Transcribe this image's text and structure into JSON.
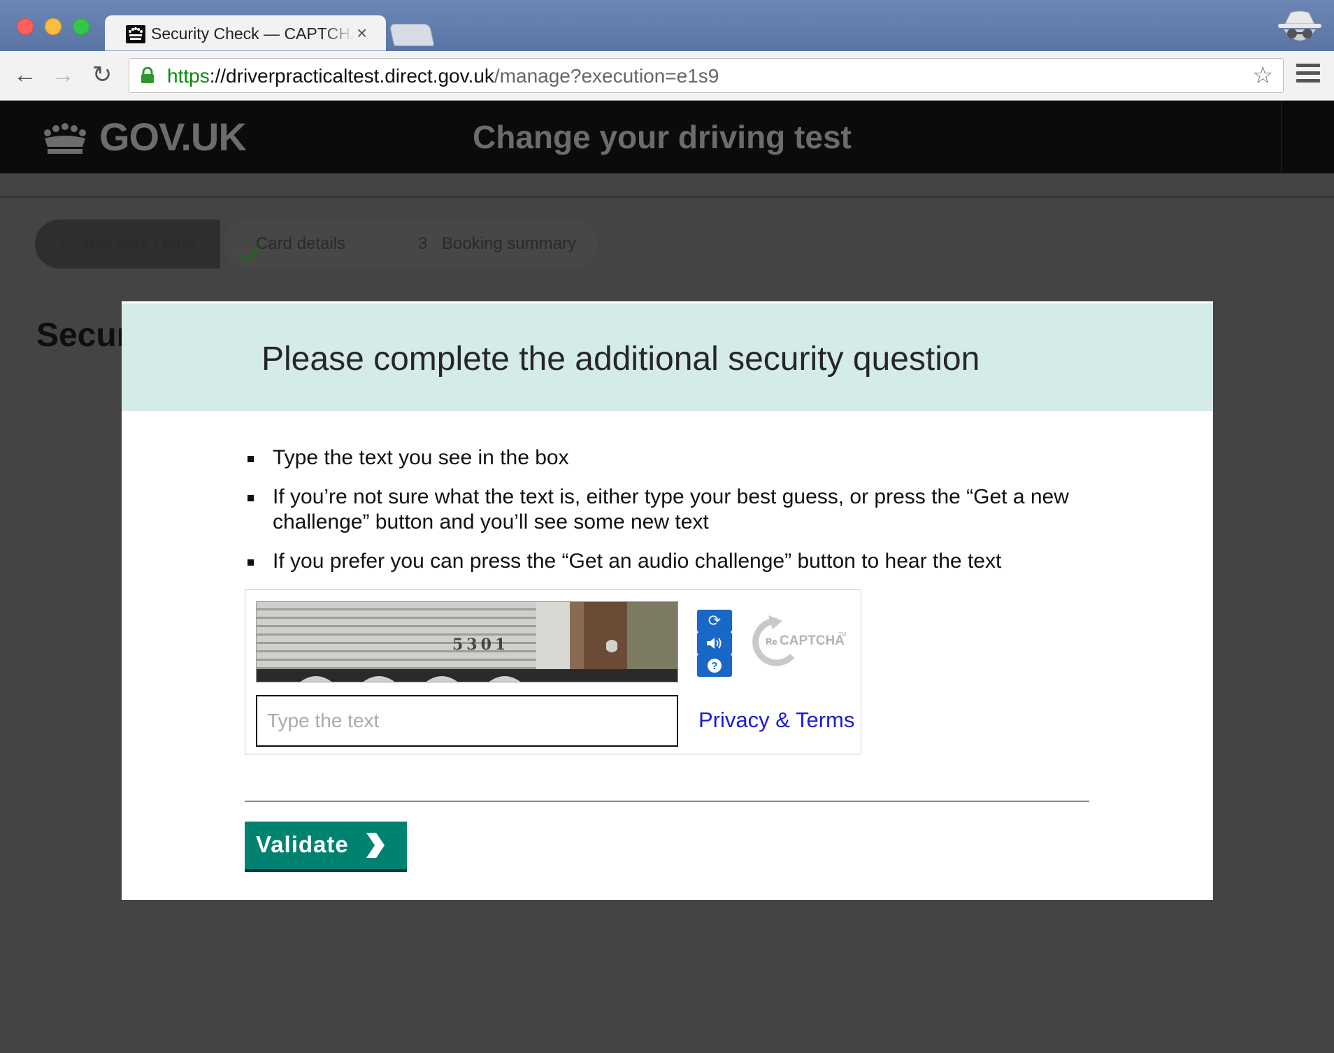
{
  "browser": {
    "tab_title": "Security Check — CAPTCHA",
    "tab_close": "×",
    "url_scheme": "https",
    "url_host": "://driverpracticaltest.direct.gov.uk",
    "url_path": "/manage?execution=e1s9",
    "nav": {
      "back": "←",
      "forward": "→",
      "reload": "↻"
    },
    "bookmark_star": "☆"
  },
  "header": {
    "logo_text": "GOV.UK",
    "service_name": "Change your driving test"
  },
  "steps": [
    {
      "number": "1",
      "label": "Test date / time",
      "state": "current"
    },
    {
      "number": "",
      "label": "Card details",
      "state": "complete"
    },
    {
      "number": "3",
      "label": "Booking summary",
      "state": "upcoming"
    }
  ],
  "page": {
    "heading": "Secur"
  },
  "modal": {
    "title": "Please complete the additional security question",
    "instructions": [
      "Type the text you see in the box",
      "If you’re not sure what the text is, either type your best guess, or press the “Get a new challenge” button and you’ll see some new text",
      "If you prefer you can press the “Get an audio challenge” button to hear the text"
    ],
    "captcha": {
      "image_text": "5301",
      "input_placeholder": "Type the text",
      "input_value": "",
      "privacy_link": "Privacy & Terms",
      "logo_prefix": "Re",
      "logo_text": "CAPTCHA",
      "logo_tm": "TM",
      "controls": {
        "refresh_icon": "⟳",
        "audio_icon": "🔊",
        "help_icon": "?"
      }
    },
    "validate_label": "Validate"
  },
  "colors": {
    "modal_header_bg": "#d5ebe8",
    "validate_bg": "#008270",
    "link": "#1b1bd6",
    "overlay": "#444444"
  }
}
